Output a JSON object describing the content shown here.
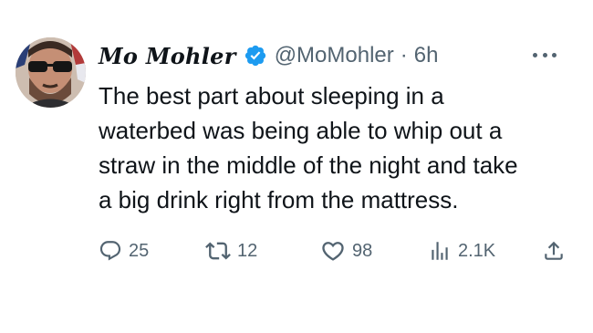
{
  "tweet": {
    "display_name": "Mo Mohler",
    "handle": "@MoMohler",
    "separator": "·",
    "time": "6h",
    "text_lines": [
      "The best part about sleeping in a",
      "waterbed was being able to whip out a",
      "straw in the middle of the night and take",
      "a big drink right from the mattress."
    ]
  },
  "actions": {
    "replies": "25",
    "retweets": "12",
    "likes": "98",
    "views": "2.1K"
  },
  "icons": {
    "verified": "verified-badge-icon",
    "more": "more-options-icon",
    "reply": "reply-icon",
    "retweet": "retweet-icon",
    "like": "heart-icon",
    "views": "views-icon",
    "share": "share-icon"
  },
  "colors": {
    "text": "#0f1419",
    "secondary": "#536471",
    "verified": "#1d9bf0"
  }
}
